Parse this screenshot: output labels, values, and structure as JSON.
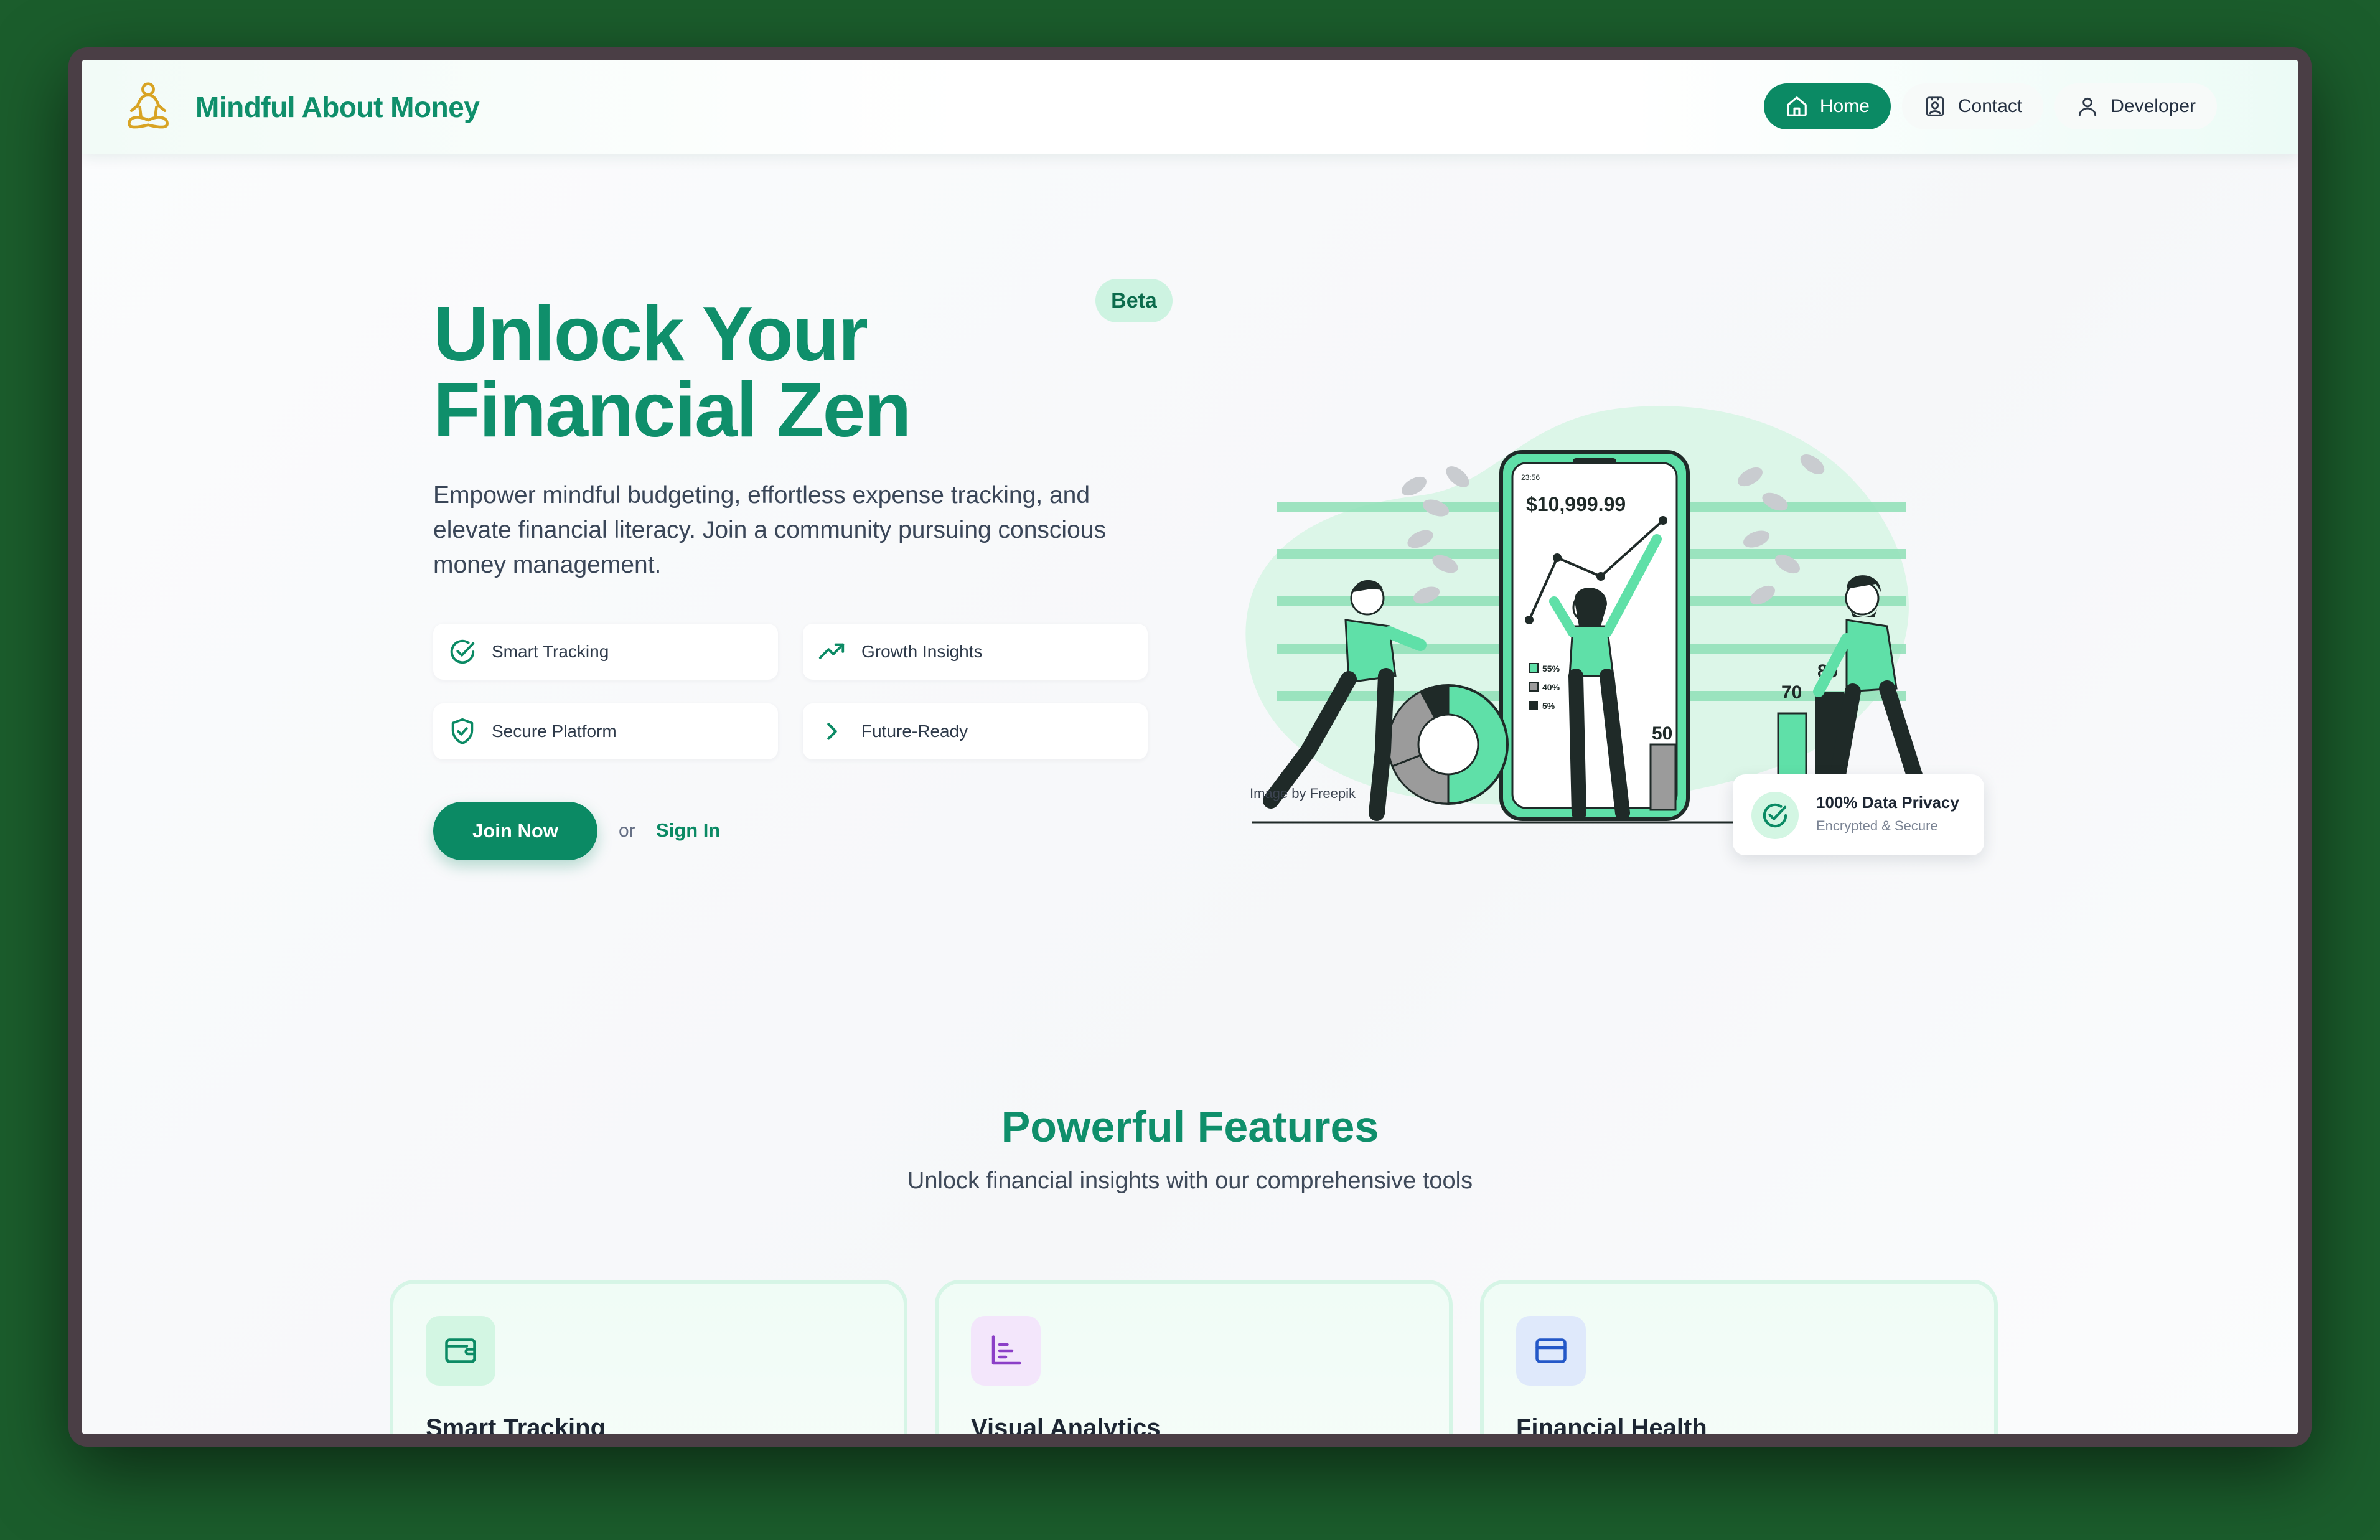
{
  "brand": {
    "name": "Mindful About Money",
    "logo_icon": "meditation-person-icon"
  },
  "nav": {
    "items": [
      {
        "label": "Home",
        "icon": "home-icon",
        "active": true
      },
      {
        "label": "Contact",
        "icon": "contact-card-icon",
        "active": false
      },
      {
        "label": "Developer",
        "icon": "user-icon",
        "active": false
      }
    ]
  },
  "hero": {
    "title_line1": "Unlock Your",
    "title_line2": "Financial Zen",
    "badge": "Beta",
    "description": "Empower mindful budgeting, effortless expense tracking, and elevate financial literacy. Join a community pursuing conscious money management.",
    "features": [
      {
        "label": "Smart Tracking",
        "icon": "check-circle-icon"
      },
      {
        "label": "Growth Insights",
        "icon": "trending-up-icon"
      },
      {
        "label": "Secure Platform",
        "icon": "shield-check-icon"
      },
      {
        "label": "Future-Ready",
        "icon": "chevron-right-icon"
      }
    ],
    "join_label": "Join Now",
    "or_label": "or",
    "signin_label": "Sign In"
  },
  "illustration": {
    "credit": "Image by Freepik",
    "phone_time": "23:56",
    "balance": "$10,999.99",
    "legend": [
      "55%",
      "40%",
      "5%"
    ],
    "bar_labels": [
      "50",
      "70",
      "80"
    ]
  },
  "privacy": {
    "title": "100% Data Privacy",
    "subtitle": "Encrypted & Secure",
    "icon": "check-circle-icon"
  },
  "features_section": {
    "title": "Powerful Features",
    "subtitle": "Unlock financial insights with our comprehensive tools",
    "cards": [
      {
        "title": "Smart Tracking",
        "icon": "wallet-icon",
        "icon_bg": "#d3f6e3",
        "icon_color": "#0b8a64"
      },
      {
        "title": "Visual Analytics",
        "icon": "bar-chart-icon",
        "icon_bg": "#f3e6fb",
        "icon_color": "#8b3fc7"
      },
      {
        "title": "Financial Health",
        "icon": "credit-card-icon",
        "icon_bg": "#dfe9fb",
        "icon_color": "#2458c8"
      }
    ]
  },
  "colors": {
    "brand_green": "#0f8f6b",
    "accent_green": "#0b8a64",
    "mint": "#5fe0a8"
  }
}
